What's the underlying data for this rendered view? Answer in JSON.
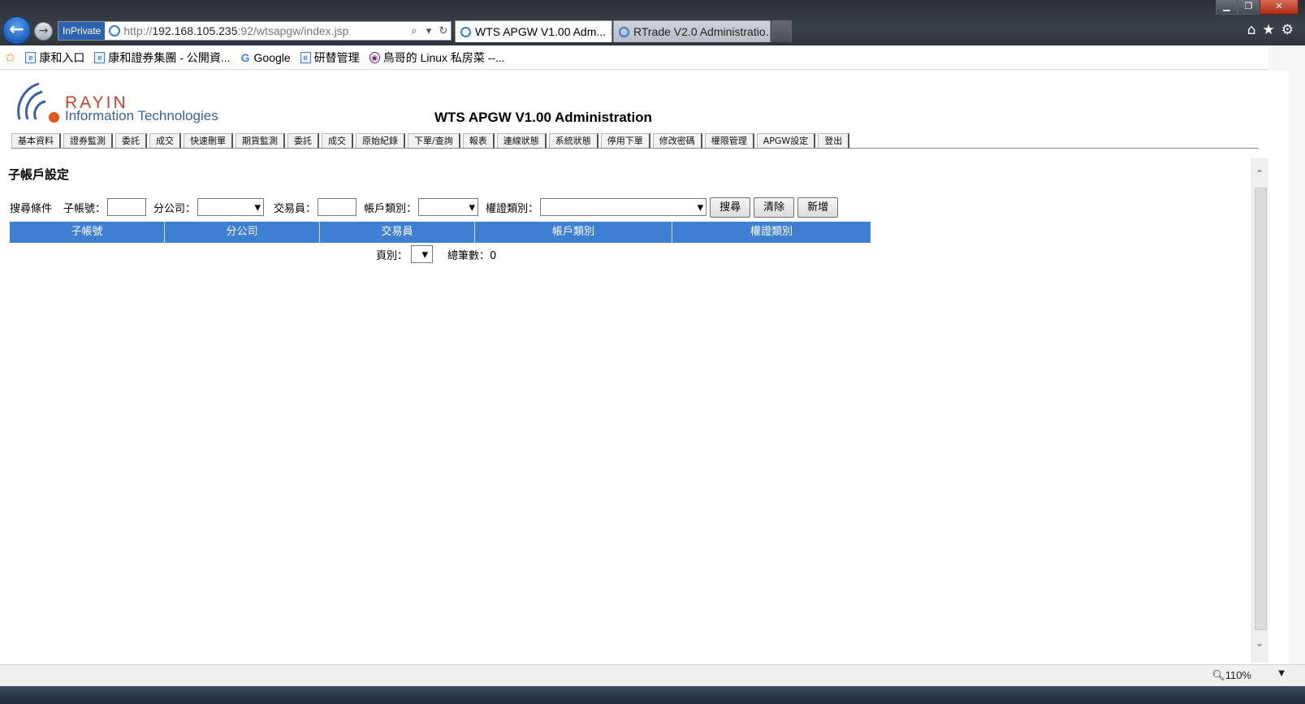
{
  "browser": {
    "inprivate_label": "InPrivate",
    "url_prefix": "http://",
    "url_host": "192.168.105.235",
    "url_rest": ":92/wtsapgw/index.jsp",
    "tabs": [
      {
        "label": "WTS APGW V1.00 Adm...",
        "active": true
      },
      {
        "label": "RTrade V2.0 Administratio...",
        "active": false
      }
    ],
    "favorites": [
      {
        "label": "康和入口",
        "icon": "ie-page-icon"
      },
      {
        "label": "康和證券集團 - 公開資...",
        "icon": "ie-page-icon"
      },
      {
        "label": "Google",
        "icon": "google-icon"
      },
      {
        "label": "研替管理",
        "icon": "ie-page-icon"
      },
      {
        "label": "鳥哥的 Linux 私房菜 --...",
        "icon": "site-icon"
      }
    ],
    "zoom": "110%"
  },
  "page": {
    "logo_word": "RAYIN",
    "logo_sub": "Information Technologies",
    "title": "WTS APGW V1.00 Administration",
    "nav_tabs": [
      "基本資料",
      "證券監測",
      "委託",
      "成交",
      "快速刪單",
      "期貨監測",
      "委託",
      "成交",
      "原始紀錄",
      "下單/查詢",
      "報表",
      "連線狀態",
      "系統狀態",
      "停用下單",
      "修改密碼",
      "權限管理",
      "APGW設定",
      "登出"
    ],
    "section_title": "子帳戶設定",
    "search": {
      "label": "搜尋條件",
      "sub_account_label": "子帳號：",
      "sub_account_value": "",
      "branch_label": "分公司：",
      "branch_value": "",
      "trader_label": "交易員：",
      "trader_value": "",
      "account_type_label": "帳戶類別：",
      "account_type_value": "",
      "permission_label": "權證類別：",
      "permission_value": "",
      "search_button": "搜尋",
      "clear_button": "清除",
      "add_button": "新增"
    },
    "table": {
      "columns": [
        "子帳號",
        "分公司",
        "交易員",
        "帳戶類別",
        "權證類別"
      ]
    },
    "pager": {
      "page_label": "頁別：",
      "page_value": "",
      "total_label": "總筆數：0"
    }
  },
  "colors": {
    "header_blue": "#3f7fd1",
    "logo_red": "#c8432c",
    "logo_blue": "#3a60a8"
  }
}
